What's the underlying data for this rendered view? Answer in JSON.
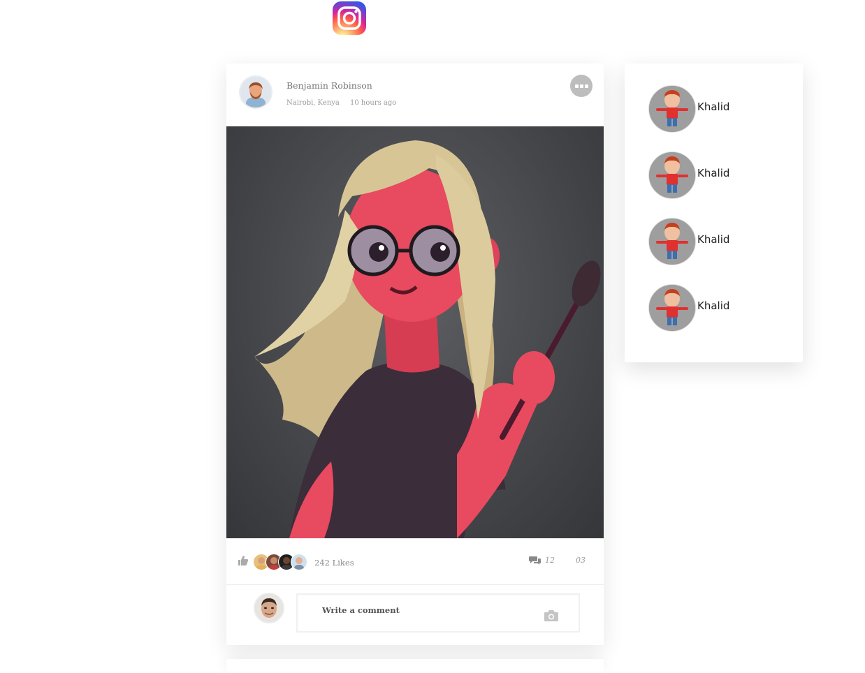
{
  "app": {
    "logo_icon": "instagram-logo-icon"
  },
  "post": {
    "author_name": "Benjamin Robinson",
    "location": "Nairobi, Kenya",
    "time_ago": "10 hours ago",
    "likes_text": "242 Likes",
    "comments_count": "12",
    "shares_count": "03",
    "comment_placeholder": "Write a comment"
  },
  "suggestions": [
    {
      "name": "Khalid"
    },
    {
      "name": "Khalid"
    },
    {
      "name": "Khalid"
    },
    {
      "name": "Khalid"
    }
  ],
  "colors": {
    "card_bg": "#ffffff",
    "muted_text": "#888888",
    "photo_bg": "#47484c",
    "character_skin": "#e84a5f",
    "hair": "#d8c596"
  }
}
